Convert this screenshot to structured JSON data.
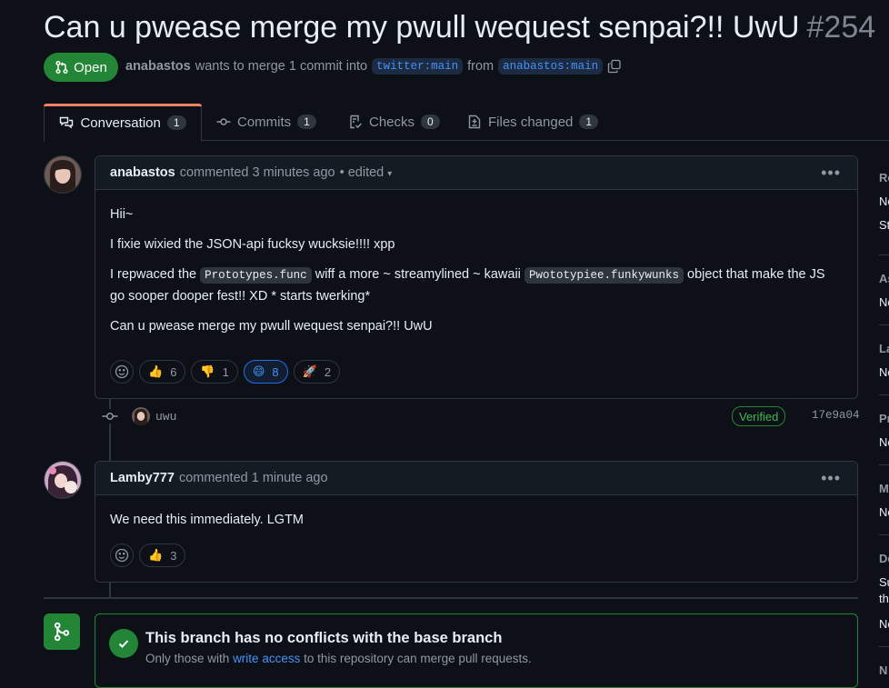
{
  "title": {
    "text": "Can u pwease merge my pwull wequest senpai?!! UwU",
    "number": "#254"
  },
  "state": {
    "label": "Open",
    "color": "#238636"
  },
  "meta": {
    "author": "anabastos",
    "text_wants": "wants to merge 1 commit into",
    "base_branch": "twitter:main",
    "text_from": "from",
    "head_branch": "anabastos:main"
  },
  "tabs": [
    {
      "label": "Conversation",
      "count": "1",
      "icon": "comment-discussion-icon"
    },
    {
      "label": "Commits",
      "count": "1",
      "icon": "git-commit-icon"
    },
    {
      "label": "Checks",
      "count": "0",
      "icon": "checklist-icon"
    },
    {
      "label": "Files changed",
      "count": "1",
      "icon": "file-diff-icon"
    }
  ],
  "comments": [
    {
      "author": "anabastos",
      "meta": "commented 3 minutes ago",
      "edited": "• edited",
      "body": {
        "p1": "Hii~",
        "p2": "I fixie wixied the JSON-api fucksy wucksie!!!! xpp",
        "p3a": "I repwaced the",
        "p3code1": "Prototypes.func",
        "p3b": "wiff a more ~ streamylined ~ kawaii",
        "p3code2": "Pwototypiee.funkywunks",
        "p3c": "object that make the JS go sooper dooper fest!! XD * starts twerking*",
        "p4": "Can u pwease merge my pwull wequest senpai?!! UwU"
      },
      "reactions": [
        {
          "emoji": "👍",
          "count": "6",
          "active": false
        },
        {
          "emoji": "👎",
          "count": "1",
          "active": false
        },
        {
          "emoji": "😄",
          "count": "8",
          "active": true
        },
        {
          "emoji": "🚀",
          "count": "2",
          "active": false
        }
      ]
    },
    {
      "author": "Lamby777",
      "meta": "commented 1 minute ago",
      "body": {
        "p1": "We need this immediately. LGTM"
      },
      "reactions": [
        {
          "emoji": "👍",
          "count": "3",
          "active": false
        }
      ]
    }
  ],
  "commit": {
    "author": "uwu",
    "verified": "Verified",
    "sha": "17e9a04"
  },
  "merge": {
    "title": "This branch has no conflicts with the base branch",
    "sub_pre": "Only those with",
    "sub_link": "write access",
    "sub_post": "to this repository can merge pull requests."
  },
  "sidebar": [
    {
      "label": "Re",
      "value": "No",
      "value2": "St"
    },
    {
      "label": "As",
      "value": "No"
    },
    {
      "label": "La",
      "value": "No"
    },
    {
      "label": "Pr",
      "value": "No"
    },
    {
      "label": "M",
      "value": "No"
    },
    {
      "label": "De",
      "value": "Su",
      "value2": "th",
      "value3": "No"
    },
    {
      "label": "N"
    }
  ]
}
